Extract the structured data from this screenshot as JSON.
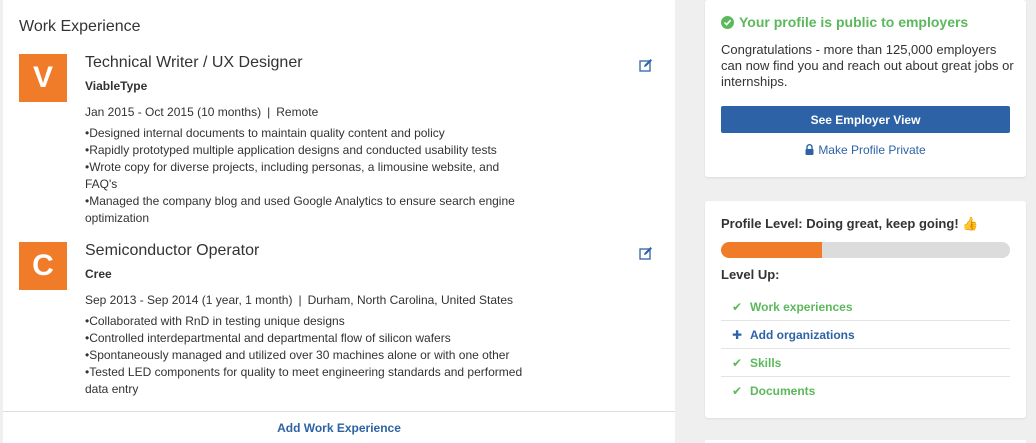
{
  "work": {
    "heading": "Work Experience",
    "jobs": [
      {
        "logo_letter": "V",
        "title": "Technical Writer / UX Designer",
        "company": "ViableType",
        "dates": "Jan 2015 - Oct 2015 (10 months)",
        "separator": "|",
        "location": "Remote",
        "bullets": [
          "Designed internal documents to maintain quality content and policy",
          "Rapidly prototyped multiple application designs and conducted usability tests",
          "Wrote copy for diverse projects, including personas, a limousine website, and FAQ's",
          "Managed the company blog and used Google Analytics to ensure search engine optimization"
        ]
      },
      {
        "logo_letter": "C",
        "title": "Semiconductor Operator",
        "company": "Cree",
        "dates": "Sep 2013 - Sep 2014 (1 year, 1 month)",
        "separator": "|",
        "location": "Durham, North Carolina, United States",
        "bullets": [
          "Collaborated with RnD in testing unique designs",
          "Controlled interdepartmental and departmental flow of silicon wafers",
          "Spontaneously managed and utilized over 30 machines alone or with one other",
          "Tested LED components for quality to meet engineering standards and performed data entry"
        ]
      }
    ],
    "add_label": "Add Work Experience"
  },
  "profile_public": {
    "status": "Your profile is public to employers",
    "message": "Congratulations - more than 125,000 employers can now find you and reach out about great jobs or internships.",
    "employer_view_label": "See Employer View",
    "make_private_label": "Make Profile Private"
  },
  "profile_level": {
    "title": "Profile Level: Doing great, keep going!",
    "emoji": "👍",
    "progress_fraction": 0.35,
    "level_up_label": "Level Up:",
    "items": [
      {
        "label": "Work experiences",
        "done": true
      },
      {
        "label": "Add organizations",
        "done": false
      },
      {
        "label": "Skills",
        "done": true
      },
      {
        "label": "Documents",
        "done": true
      }
    ]
  },
  "colors": {
    "accent_blue": "#2d63a6",
    "success_green": "#5cb85c",
    "brand_orange": "#f07c2a"
  },
  "icons": {
    "edit": "edit-icon",
    "check": "check-icon",
    "plus": "plus-icon",
    "lock": "lock-icon"
  }
}
